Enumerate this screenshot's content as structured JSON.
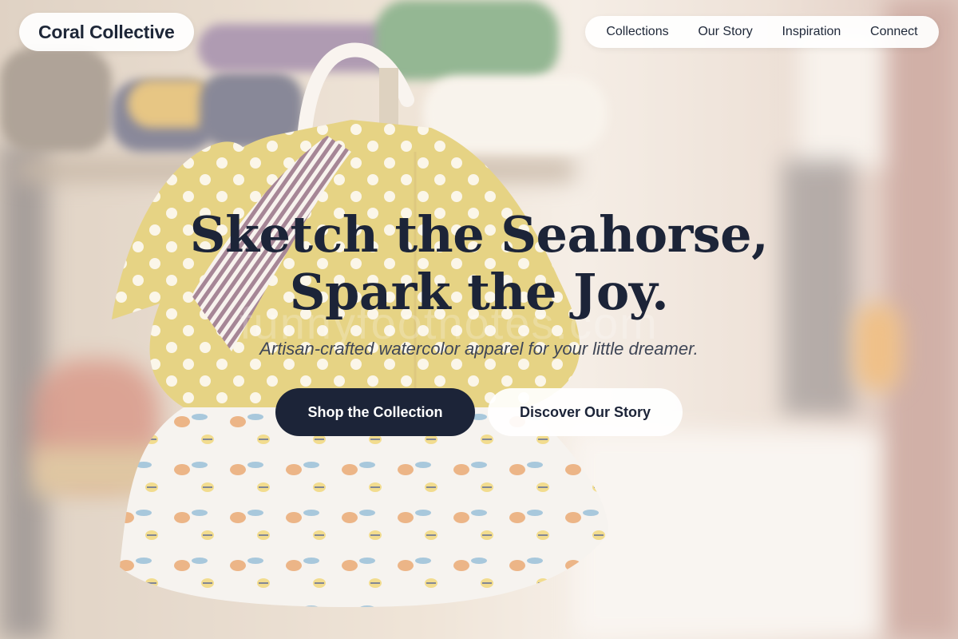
{
  "brand": {
    "name": "Coral Collective"
  },
  "nav": {
    "items": [
      {
        "label": "Collections"
      },
      {
        "label": "Our Story"
      },
      {
        "label": "Inspiration"
      },
      {
        "label": "Connect"
      }
    ]
  },
  "hero": {
    "title_line1": "Sketch the Seahorse,",
    "title_line2": "Spark the Joy.",
    "subtitle": "Artisan-crafted watercolor apparel for your little dreamer.",
    "watermark": "funnyfootnotes.com"
  },
  "actions": {
    "primary_label": "Shop the Collection",
    "secondary_label": "Discover Our Story"
  },
  "colors": {
    "ink": "#1c2438",
    "dress_yellow": "#d6b93a",
    "background_blur": "#e6d7c5"
  }
}
